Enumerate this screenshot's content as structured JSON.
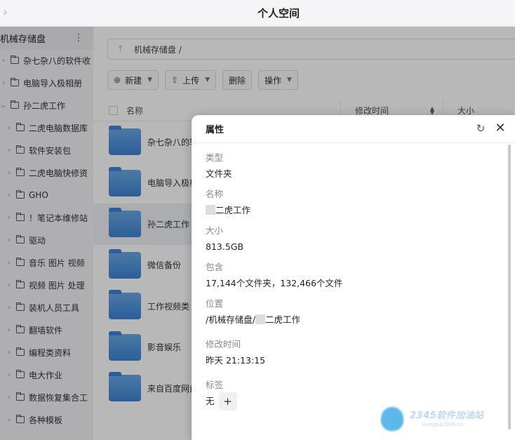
{
  "window": {
    "title": "个人空间"
  },
  "sidebar": {
    "root_label": "机械存储盘",
    "items": [
      {
        "label": "杂七杂八的软件收"
      },
      {
        "label": "电脑导入极相册"
      },
      {
        "label": "孙二虎工作",
        "expanded": true
      },
      {
        "label": "二虎电脑数据库"
      },
      {
        "label": "软件安装包"
      },
      {
        "label": "二虎电脑快修资"
      },
      {
        "label": "GHO"
      },
      {
        "label": "！笔记本维修站"
      },
      {
        "label": "驱动"
      },
      {
        "label": "音乐 图片 视频"
      },
      {
        "label": "视频 图片 处理"
      },
      {
        "label": "装机人员工具"
      },
      {
        "label": "翻墙软件"
      },
      {
        "label": "编程类资料"
      },
      {
        "label": "电大作业"
      },
      {
        "label": "数据恢复集合工"
      },
      {
        "label": "各种模板"
      }
    ]
  },
  "main": {
    "path": "机械存储盘 /",
    "toolbar": {
      "new_label": "新建",
      "upload_label": "上传",
      "delete_label": "删除",
      "action_label": "操作"
    },
    "columns": {
      "name": "名称",
      "mtime": "修改时间",
      "size": "大小"
    },
    "files": [
      {
        "name": "杂七杂八的软"
      },
      {
        "name": "电脑导入极相"
      },
      {
        "name": "孙二虎工作",
        "selected": true
      },
      {
        "name": "微信备份"
      },
      {
        "name": "工作视频类"
      },
      {
        "name": "影音娱乐"
      },
      {
        "name": "来自百度网盘"
      }
    ]
  },
  "dialog": {
    "title": "属性",
    "type_label": "类型",
    "type_value": "文件夹",
    "name_label": "名称",
    "name_value": "二虎工作",
    "size_label": "大小",
    "size_value": "813.5GB",
    "contains_label": "包含",
    "contains_value": "17,144个文件夹，132,466个文件",
    "location_label": "位置",
    "location_prefix": "/机械存储盘/",
    "location_suffix": "二虎工作",
    "mtime_label": "修改时间",
    "mtime_value": "昨天 21:13:15",
    "tags_label": "标签",
    "tags_value": "无",
    "add_tag": "+"
  },
  "watermark": {
    "line1": "2345软件加油站",
    "line2": "wangpai2345.cn"
  }
}
